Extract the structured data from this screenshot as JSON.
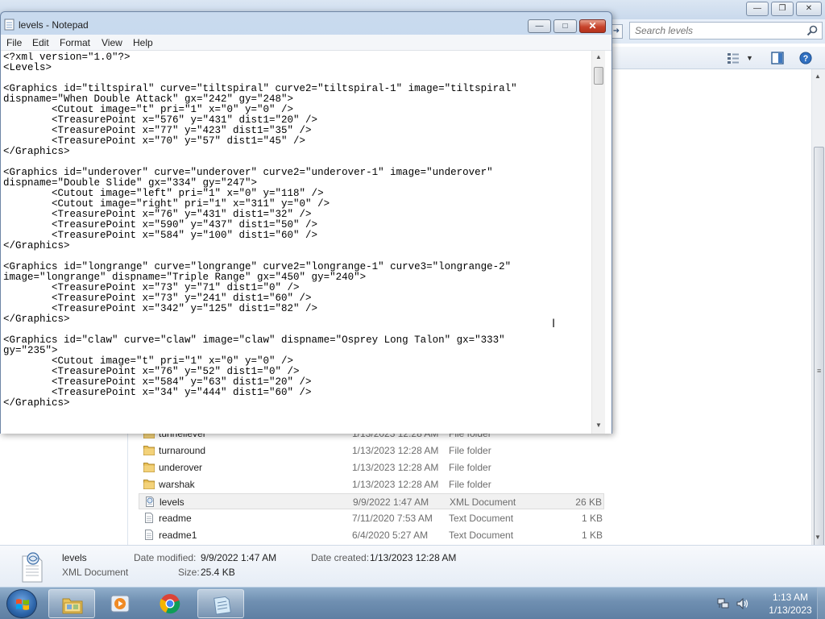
{
  "explorer": {
    "search": {
      "placeholder": "Search levels"
    },
    "files": [
      {
        "name": "tunnellever",
        "date": "1/13/2023 12:28 AM",
        "type": "File folder",
        "size": "",
        "kind": "folder"
      },
      {
        "name": "turnaround",
        "date": "1/13/2023 12:28 AM",
        "type": "File folder",
        "size": "",
        "kind": "folder"
      },
      {
        "name": "underover",
        "date": "1/13/2023 12:28 AM",
        "type": "File folder",
        "size": "",
        "kind": "folder"
      },
      {
        "name": "warshak",
        "date": "1/13/2023 12:28 AM",
        "type": "File folder",
        "size": "",
        "kind": "folder"
      },
      {
        "name": "levels",
        "date": "9/9/2022 1:47 AM",
        "type": "XML Document",
        "size": "26 KB",
        "kind": "xml",
        "selected": true
      },
      {
        "name": "readme",
        "date": "7/11/2020 7:53 AM",
        "type": "Text Document",
        "size": "1 KB",
        "kind": "text"
      },
      {
        "name": "readme1",
        "date": "6/4/2020 5:27 AM",
        "type": "Text Document",
        "size": "1 KB",
        "kind": "text"
      }
    ],
    "details": {
      "name": "levels",
      "type": "XML Document",
      "date_modified_label": "Date modified:",
      "date_modified": "9/9/2022 1:47 AM",
      "date_created_label": "Date created:",
      "date_created": "1/13/2023 12:28 AM",
      "size_label": "Size:",
      "size": "25.4 KB"
    }
  },
  "notepad": {
    "title": "levels - Notepad",
    "menu": [
      "File",
      "Edit",
      "Format",
      "View",
      "Help"
    ],
    "content": "<?xml version=\"1.0\"?>\n<Levels>\n\n<Graphics id=\"tiltspiral\" curve=\"tiltspiral\" curve2=\"tiltspiral-1\" image=\"tiltspiral\"\ndispname=\"When Double Attack\" gx=\"242\" gy=\"248\">\n        <Cutout image=\"t\" pri=\"1\" x=\"0\" y=\"0\" />\n        <TreasurePoint x=\"576\" y=\"431\" dist1=\"20\" />\n        <TreasurePoint x=\"77\" y=\"423\" dist1=\"35\" />\n        <TreasurePoint x=\"70\" y=\"57\" dist1=\"45\" />\n</Graphics>\n\n<Graphics id=\"underover\" curve=\"underover\" curve2=\"underover-1\" image=\"underover\"\ndispname=\"Double Slide\" gx=\"334\" gy=\"247\">\n        <Cutout image=\"left\" pri=\"1\" x=\"0\" y=\"118\" />\n        <Cutout image=\"right\" pri=\"1\" x=\"311\" y=\"0\" />\n        <TreasurePoint x=\"76\" y=\"431\" dist1=\"32\" />\n        <TreasurePoint x=\"590\" y=\"437\" dist1=\"50\" />\n        <TreasurePoint x=\"584\" y=\"100\" dist1=\"60\" />\n</Graphics>\n\n<Graphics id=\"longrange\" curve=\"longrange\" curve2=\"longrange-1\" curve3=\"longrange-2\"\nimage=\"longrange\" dispname=\"Triple Range\" gx=\"450\" gy=\"240\">\n        <TreasurePoint x=\"73\" y=\"71\" dist1=\"0\" />\n        <TreasurePoint x=\"73\" y=\"241\" dist1=\"60\" />\n        <TreasurePoint x=\"342\" y=\"125\" dist1=\"82\" />\n</Graphics>\n\n<Graphics id=\"claw\" curve=\"claw\" image=\"claw\" dispname=\"Osprey Long Talon\" gx=\"333\"\ngy=\"235\">\n        <Cutout image=\"t\" pri=\"1\" x=\"0\" y=\"0\" />\n        <TreasurePoint x=\"76\" y=\"52\" dist1=\"0\" />\n        <TreasurePoint x=\"584\" y=\"63\" dist1=\"20\" />\n        <TreasurePoint x=\"34\" y=\"444\" dist1=\"60\" />\n</Graphics>\n"
  },
  "taskbar": {
    "apps": [
      "windows-explorer",
      "media-player",
      "chrome",
      "notepad"
    ],
    "clock": {
      "time": "1:13 AM",
      "date": "1/13/2023"
    }
  }
}
